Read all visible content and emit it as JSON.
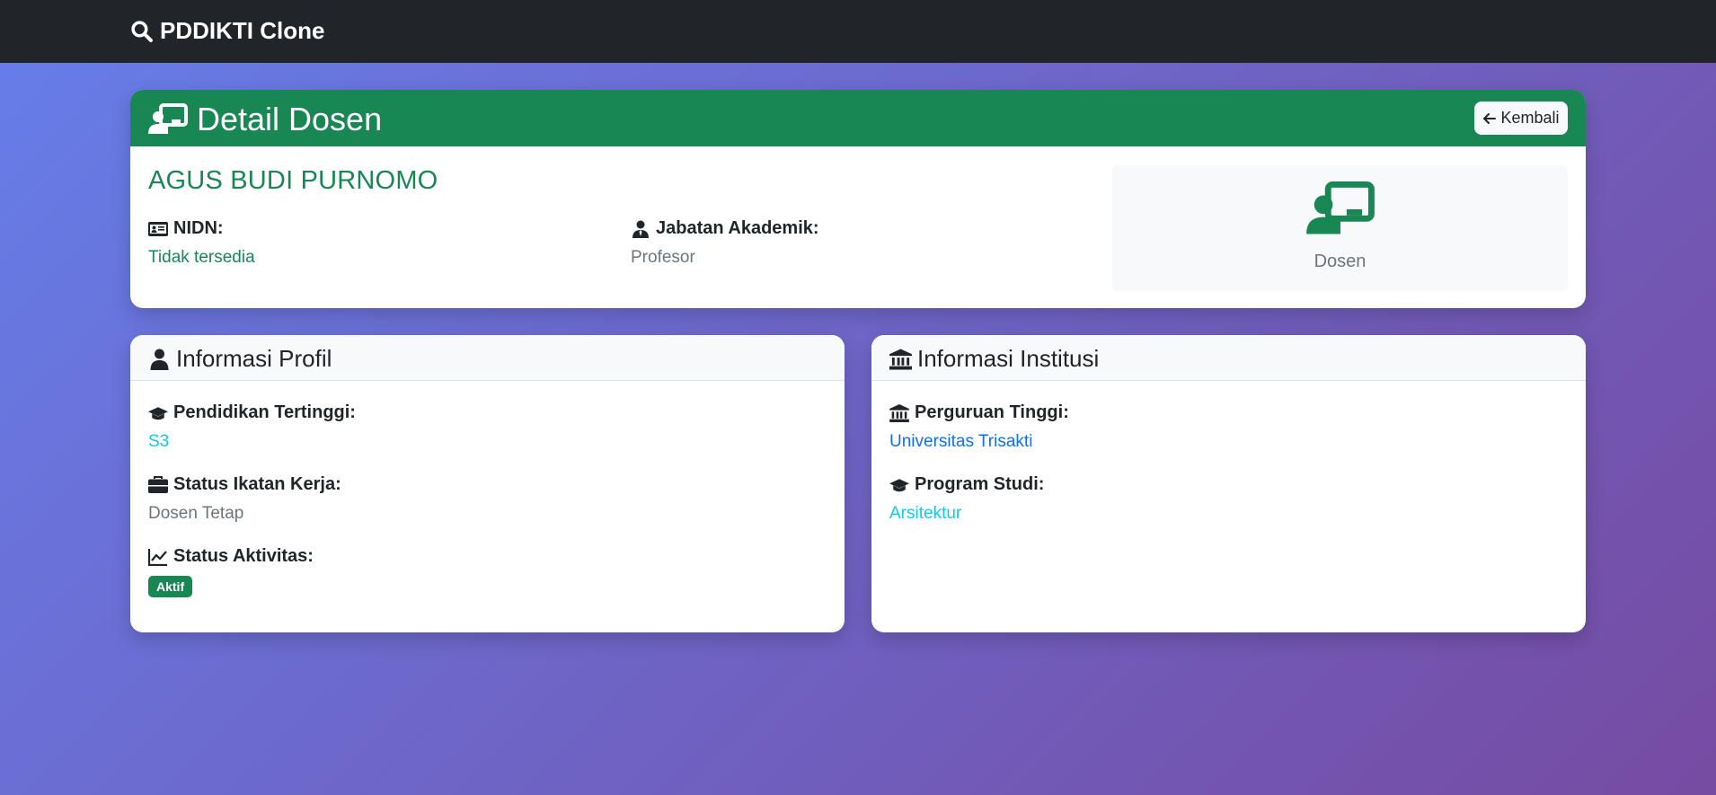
{
  "navbar": {
    "brand": "PDDIKTI Clone",
    "brand_icon": "search-icon"
  },
  "detail": {
    "title": "Detail Dosen",
    "back_label": "Kembali",
    "name": "AGUS BUDI PURNOMO",
    "nidn_label": "NIDN:",
    "nidn_value": "Tidak tersedia",
    "jabatan_label": "Jabatan Akademik:",
    "jabatan_value": "Profesor",
    "role_label": "Dosen"
  },
  "profile": {
    "title": "Informasi Profil",
    "pendidikan_label": "Pendidikan Tertinggi:",
    "pendidikan_value": "S3",
    "ikatan_label": "Status Ikatan Kerja:",
    "ikatan_value": "Dosen Tetap",
    "aktivitas_label": "Status Aktivitas:",
    "aktivitas_badge": "Aktif"
  },
  "institusi": {
    "title": "Informasi Institusi",
    "pt_label": "Perguruan Tinggi:",
    "pt_value": "Universitas Trisakti",
    "prodi_label": "Program Studi:",
    "prodi_value": "Arsitektur"
  },
  "colors": {
    "success": "#198754",
    "dark": "#212529",
    "info": "#0dcaf0",
    "primary": "#0d6efd",
    "gradient_start": "#667eea",
    "gradient_end": "#764ba2"
  }
}
